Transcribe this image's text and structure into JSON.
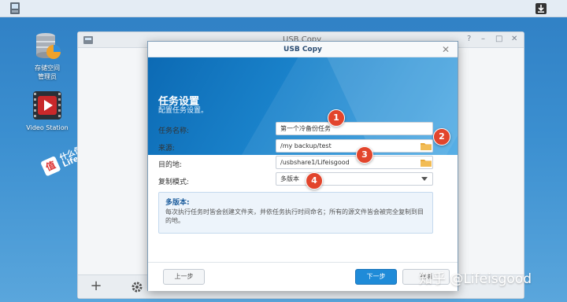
{
  "desktop": {
    "storage_manager_label": "存储空间管理员",
    "video_station_label": "Video Station",
    "watermark_line1": "什么值得买",
    "watermark_line2": "Lifeisgood"
  },
  "background_window": {
    "title": "USB Copy",
    "controls": [
      "?",
      "–",
      "□",
      "✕"
    ]
  },
  "dialog": {
    "title": "USB Copy",
    "close": "✕",
    "banner": {
      "heading": "任务设置",
      "subheading": "配置任务设置。"
    },
    "fields": {
      "task_name_label": "任务名称:",
      "task_name_value": "第一个冷备份任务",
      "source_label": "来源:",
      "source_value": "/my backup/test",
      "destination_label": "目的地:",
      "destination_value": "/usbshare1/Lifeisgood",
      "copy_mode_label": "复制模式:",
      "copy_mode_value": "多版本"
    },
    "info": {
      "heading": "多版本:",
      "body": "每次执行任务时皆会创建文件夹，并依任务执行时间命名；所有的源文件皆会被完全复制到目的地。"
    },
    "buttons": {
      "prev": "上一步",
      "next": "下一步",
      "cancel": "取消"
    }
  },
  "markers": [
    "1",
    "2",
    "3",
    "4"
  ],
  "watermark_right": "知乎 @Lifeisgood",
  "colors": {
    "accent": "#1f8bd8",
    "marker": "#e2452c",
    "folder": "#e8a93a"
  }
}
